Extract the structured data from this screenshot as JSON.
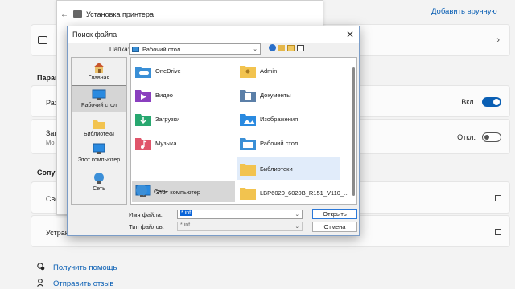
{
  "settings": {
    "add_manual": "Добавить вручную",
    "section_params": "Парам",
    "section_support": "Сопут",
    "rows": {
      "row1_label": "Раз",
      "row2_label": "Заг",
      "row2_sub": "Мо",
      "row3_label": "Свс",
      "row4_label": "Устран"
    },
    "toggle1_text": "Вкл.",
    "toggle2_text": "Откл.",
    "help_link": "Получить помощь",
    "feedback_link": "Отправить отзыв"
  },
  "installer": {
    "title": "Установка принтера"
  },
  "dialog": {
    "title": "Поиск файла",
    "folder_label": "Папка:",
    "folder_value": "Рабочий стол",
    "places": [
      {
        "label": "Главная",
        "icon": "home-icon"
      },
      {
        "label": "Рабочий стол",
        "icon": "desktop-icon",
        "selected": true
      },
      {
        "label": "Библиотеки",
        "icon": "libraries-icon"
      },
      {
        "label": "Этот компьютер",
        "icon": "computer-icon"
      },
      {
        "label": "Сеть",
        "icon": "network-icon"
      }
    ],
    "items": [
      {
        "label": "OneDrive",
        "icon": "onedrive-folder-icon"
      },
      {
        "label": "Admin",
        "icon": "user-folder-icon"
      },
      {
        "label": "Видео",
        "icon": "video-folder-icon"
      },
      {
        "label": "Документы",
        "icon": "documents-folder-icon"
      },
      {
        "label": "Загрузки",
        "icon": "downloads-folder-icon"
      },
      {
        "label": "Изображения",
        "icon": "pictures-folder-icon"
      },
      {
        "label": "Музыка",
        "icon": "music-folder-icon"
      },
      {
        "label": "Рабочий стол",
        "icon": "desktop-folder-icon"
      },
      {
        "label": "Этот компьютер",
        "icon": "computer-icon",
        "selected": true
      },
      {
        "label": "Библиотеки",
        "icon": "libraries-folder-icon",
        "hovered": true
      },
      {
        "label": "Сеть",
        "icon": "network-icon"
      },
      {
        "label": "LBP6020_6020B_R151_V110_...",
        "icon": "folder-icon"
      }
    ],
    "filename_label": "Имя файла:",
    "filename_value": "*.inf",
    "filetype_label": "Тип файлов:",
    "filetype_value": "*.inf",
    "open_button": "Открыть",
    "cancel_button": "Отмена"
  },
  "colors": {
    "accent": "#0a5fb4",
    "selection": "#0a64d8"
  }
}
